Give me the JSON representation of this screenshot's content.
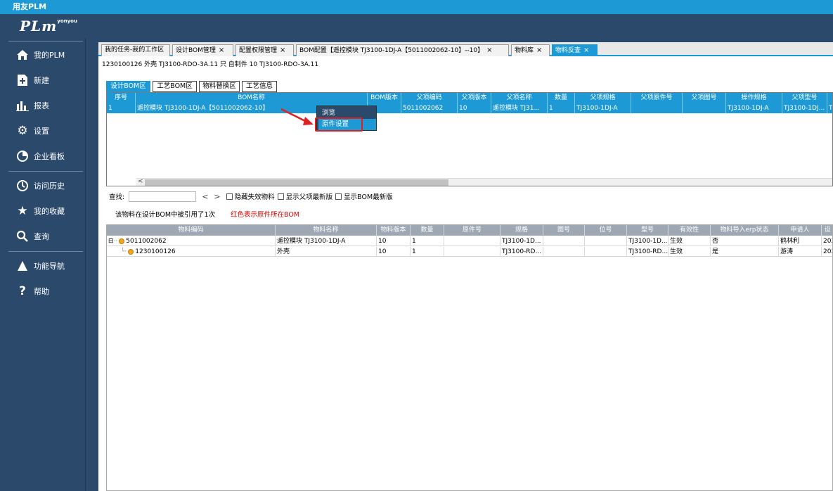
{
  "app": {
    "title": "用友PLM",
    "logo_text": "PLm",
    "logo_sup": "yonyou"
  },
  "sidebar": {
    "items": [
      {
        "label": "我的PLM",
        "icon": "home-icon"
      },
      {
        "label": "新建",
        "icon": "new-doc-icon"
      },
      {
        "label": "报表",
        "icon": "bar-chart-icon"
      },
      {
        "label": "设置",
        "icon": "gear-icon"
      },
      {
        "label": "企业看板",
        "icon": "pie-chart-icon"
      },
      {
        "label": "访问历史",
        "icon": "history-clock-icon"
      },
      {
        "label": "我的收藏",
        "icon": "star-icon"
      },
      {
        "label": "查询",
        "icon": "search-icon"
      },
      {
        "label": "功能导航",
        "icon": "navigation-triangle-icon"
      },
      {
        "label": "帮助",
        "icon": "help-question-icon"
      }
    ]
  },
  "tabs": [
    {
      "label": "我的任务-我的工作区",
      "closable": false
    },
    {
      "label": "设计BOM管理",
      "closable": true
    },
    {
      "label": "配置权限管理",
      "closable": true
    },
    {
      "label": "BOM配置【遥控模块  TJ3100-1DJ-A【5011002062-10】--10】",
      "closable": true
    },
    {
      "label": "物料库",
      "closable": true
    },
    {
      "label": "物料反查",
      "closable": true,
      "active": true
    }
  ],
  "info_line": "1230100126 外壳 TJ3100-RDO-3A.11 只 自制件 10 TJ3100-RDO-3A.11",
  "subtabs": [
    {
      "label": "设计BOM区",
      "active": true
    },
    {
      "label": "工艺BOM区"
    },
    {
      "label": "物料替换区"
    },
    {
      "label": "工艺信息"
    }
  ],
  "bom_table": {
    "columns": [
      "序号",
      "BOM名称",
      "BOM版本",
      "父项编码",
      "父项版本",
      "父项名称",
      "数量",
      "父项规格",
      "父项原件号",
      "父项图号",
      "操作规格",
      "父项型号"
    ],
    "rows": [
      [
        "1",
        "遥控模块  TJ3100-1DJ-A【5011002062-10】",
        "",
        "5011002062",
        "10",
        "遥控模块  TJ31...",
        "1",
        "TJ3100-1DJ-A",
        "",
        "",
        "TJ3100-1DJ-A",
        "TJ3100-1DJ..."
      ]
    ],
    "overflow_cell": "TJ"
  },
  "context_menu": {
    "items": [
      "浏览",
      "原件设置"
    ],
    "highlighted": "原件设置"
  },
  "search": {
    "label": "查找:",
    "placeholder": "",
    "prev": "<",
    "next": ">",
    "checkboxes": [
      "隐藏失效物料",
      "显示父项最新版",
      "显示BOM最新版"
    ]
  },
  "notes": {
    "usage": "该物料在设计BOM中被引用了1次",
    "red_hint": "红色表示原件所在BOM"
  },
  "tree_table": {
    "columns": [
      "物料编码",
      "物料名称",
      "物料版本",
      "数量",
      "原件号",
      "规格",
      "图号",
      "位号",
      "型号",
      "有效性",
      "物料导入erp状态",
      "申请人",
      "设"
    ],
    "rows": [
      [
        "5011002062",
        "遥控模块  TJ3100-1DJ-A",
        "10",
        "1",
        "",
        "TJ3100-1D...",
        "",
        "",
        "TJ3100-1D...",
        "生效",
        "否",
        "鹤林利",
        "202"
      ],
      [
        "1230100126",
        "外壳",
        "10",
        "1",
        "",
        "TJ3100-RD...",
        "",
        "",
        "TJ3100-RD...",
        "生效",
        "是",
        "游涛",
        "202"
      ]
    ]
  },
  "colors": {
    "accent": "#1d9ad6",
    "sidebar": "#2b4a6b",
    "red": "#e02020"
  }
}
